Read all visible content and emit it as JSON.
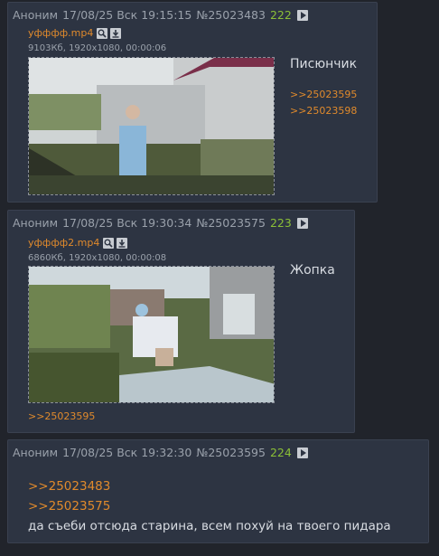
{
  "posts": [
    {
      "author": "Аноним",
      "date": "17/08/25 Вск 19:15:15",
      "number": "№25023483",
      "count": "222",
      "file_name": "уфффф.mp4",
      "file_meta": "9103Кб, 1920x1080, 00:00:06",
      "message": "Писюнчик",
      "replies": [
        ">>25023595",
        ">>25023598"
      ]
    },
    {
      "author": "Аноним",
      "date": "17/08/25 Вск 19:30:34",
      "number": "№25023575",
      "count": "223",
      "file_name": "уфффф2.mp4",
      "file_meta": "6860Кб, 1920x1080, 00:00:08",
      "message": "Жопка",
      "replies": [
        ">>25023595"
      ]
    },
    {
      "author": "Аноним",
      "date": "17/08/25 Вск 19:32:30",
      "number": "№25023595",
      "count": "224",
      "quotes": [
        ">>25023483",
        ">>25023575"
      ],
      "message": "да съеби отсюда старина, всем похуй на твоего пидара"
    }
  ],
  "colors": {
    "link": "#e08a2c",
    "count": "#8bbf37",
    "post_bg": "#2d3442",
    "page_bg": "#21242b"
  },
  "icons": [
    "play-icon",
    "search-icon",
    "download-icon"
  ]
}
